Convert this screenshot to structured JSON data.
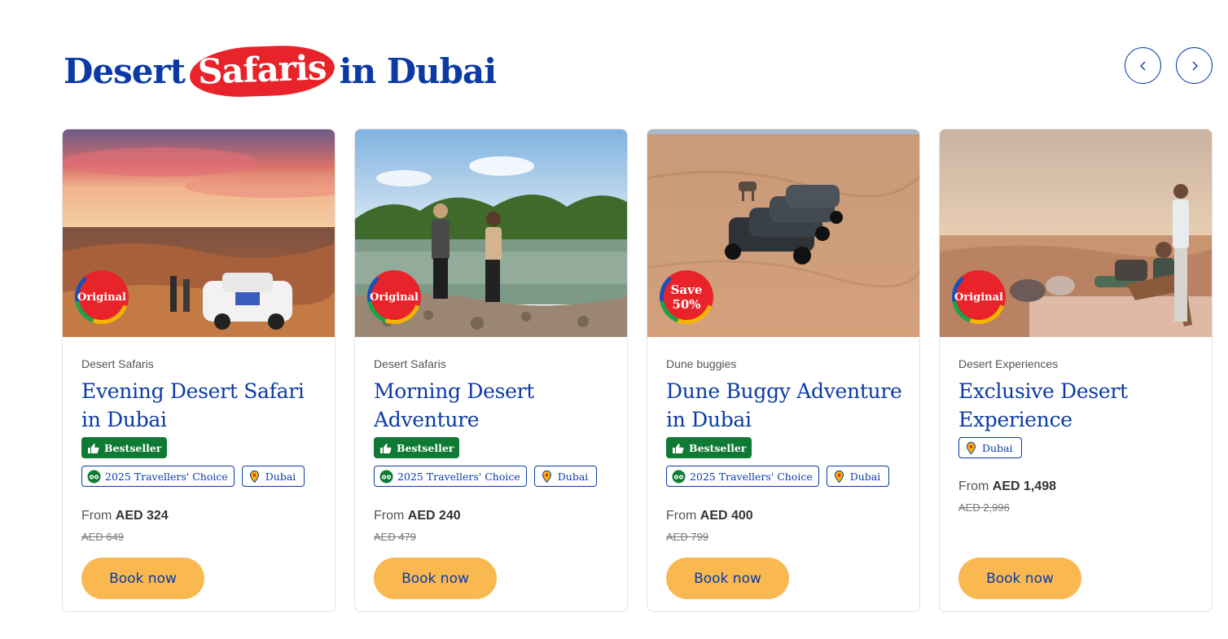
{
  "heading": {
    "before": "Desert",
    "highlight": "Safaris",
    "after": "in Dubai"
  },
  "nav": {
    "prev_icon": "chevron-left-icon",
    "next_icon": "chevron-right-icon"
  },
  "colors": {
    "brand_blue": "#0b3aa6",
    "accent_red": "#e8232a",
    "button_yellow": "#f9b850",
    "bestseller_green": "#0f7a34"
  },
  "cards": [
    {
      "category": "Desert Safaris",
      "title": "Evening Desert Safari in Dubai",
      "badge": "Original",
      "tags": {
        "bestseller": "Bestseller",
        "travellers_choice": "2025 Travellers' Choice",
        "city": "Dubai"
      },
      "price_prefix": "From",
      "price": "AED 324",
      "old_price": "AED 649",
      "button": "Book now"
    },
    {
      "category": "Desert Safaris",
      "title": "Morning Desert Adventure",
      "badge": "Original",
      "tags": {
        "bestseller": "Bestseller",
        "travellers_choice": "2025 Travellers' Choice",
        "city": "Dubai"
      },
      "price_prefix": "From",
      "price": "AED 240",
      "old_price": "AED 479",
      "button": "Book now"
    },
    {
      "category": "Dune buggies",
      "title": "Dune Buggy Adventure in Dubai",
      "badge": "Save\n50%",
      "tags": {
        "bestseller": "Bestseller",
        "travellers_choice": "2025 Travellers' Choice",
        "city": "Dubai"
      },
      "price_prefix": "From",
      "price": "AED 400",
      "old_price": "AED 799",
      "button": "Book now"
    },
    {
      "category": "Desert Experiences",
      "title": "Exclusive Desert Experience",
      "badge": "Original",
      "tags": {
        "city": "Dubai"
      },
      "price_prefix": "From",
      "price": "AED 1,498",
      "old_price": "AED 2,996",
      "button": "Book now"
    }
  ]
}
